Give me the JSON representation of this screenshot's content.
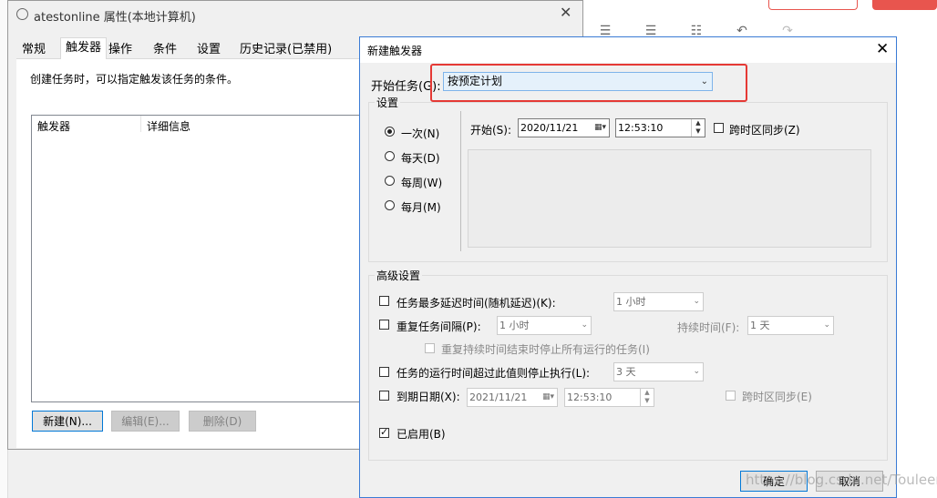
{
  "property_window": {
    "title": "atestonline 属性(本地计算机)",
    "tabs": [
      "常规",
      "触发器",
      "操作",
      "条件",
      "设置",
      "历史记录(已禁用)"
    ],
    "description": "创建任务时，可以指定触发该任务的条件。",
    "columns": [
      "触发器",
      "详细信息"
    ],
    "buttons": {
      "new": "新建(N)...",
      "edit": "编辑(E)...",
      "delete": "删除(D)"
    }
  },
  "dialog": {
    "title": "新建触发器",
    "start_task_label": "开始任务(G):",
    "start_task_value": "按预定计划",
    "settings_label": "设置",
    "schedule_options": [
      "一次(N)",
      "每天(D)",
      "每周(W)",
      "每月(M)"
    ],
    "selected_schedule": "一次(N)",
    "start_label": "开始(S):",
    "start_date": "2020/11/21",
    "start_time": "12:53:10",
    "sync_timezone_label": "跨时区同步(Z)",
    "advanced_label": "高级设置",
    "delay_label": "任务最多延迟时间(随机延迟)(K):",
    "delay_value": "1 小时",
    "repeat_label": "重复任务间隔(P):",
    "repeat_value": "1 小时",
    "duration_label": "持续时间(F):",
    "duration_value": "1 天",
    "stop_repeat_label": "重复持续时间结束时停止所有运行的任务(I)",
    "stop_longer_label": "任务的运行时间超过此值则停止执行(L):",
    "stop_longer_value": "3 天",
    "expire_label": "到期日期(X):",
    "expire_date": "2021/11/21",
    "expire_time": "12:53:10",
    "expire_sync_label": "跨时区同步(E)",
    "enabled_label": "已启用(B)",
    "ok_label": "确定",
    "cancel_label": "取消"
  },
  "watermark": "https://blog.csdn.net/Touleer",
  "colors": {
    "highlight_box": "#e53935",
    "accent": "#0078d7",
    "brand_button": "#e8554e"
  },
  "icons": [
    "clock-icon",
    "close-icon",
    "calendar-icon",
    "chevron-down-icon",
    "undo-icon",
    "redo-icon"
  ]
}
